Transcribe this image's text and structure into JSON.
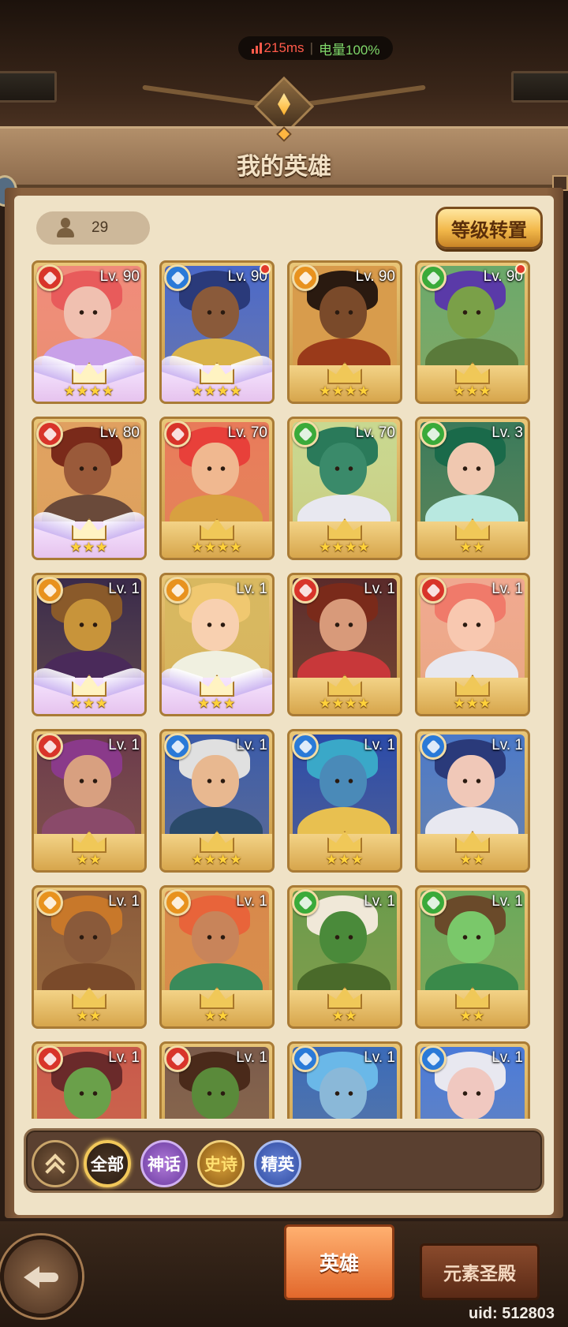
{
  "status": {
    "ping": "215ms",
    "battery": "电量100%"
  },
  "header": {
    "title": "我的英雄"
  },
  "toolbar": {
    "hero_count": "29",
    "level_transfer_label": "等级转置"
  },
  "colors": {
    "fire": "#d8342a",
    "water": "#2a7ad8",
    "earth": "#e8921e",
    "nature": "#3aaa3a"
  },
  "heroes": [
    {
      "level": "Lv. 90",
      "element": "fire",
      "stars": "★★★★",
      "pink": true,
      "dot": false,
      "hair": "#e85b5b",
      "skin": "#f0c0b0",
      "outfit": "#c8a0e8",
      "bg": "#f08a7a"
    },
    {
      "level": "Lv. 90",
      "element": "water",
      "stars": "★★★★",
      "pink": true,
      "dot": true,
      "hair": "#2a3a7a",
      "skin": "#8a5a3a",
      "outfit": "#d9b24a",
      "bg": "#4a68c8"
    },
    {
      "level": "Lv. 90",
      "element": "earth",
      "stars": "★★★★",
      "pink": false,
      "dot": false,
      "hair": "#2a1a10",
      "skin": "#7a4a2a",
      "outfit": "#9a3a1a",
      "bg": "#d89a4a"
    },
    {
      "level": "Lv. 90",
      "element": "nature",
      "stars": "★★★",
      "pink": false,
      "dot": true,
      "hair": "#5a3aa8",
      "skin": "#7aa048",
      "outfit": "#5a7a3a",
      "bg": "#6aa86a"
    },
    {
      "level": "Lv. 80",
      "element": "fire",
      "stars": "★★★",
      "pink": true,
      "dot": false,
      "hair": "#7a2a1a",
      "skin": "#9a5a3a",
      "outfit": "#6a4a3a",
      "bg": "#e0a060"
    },
    {
      "level": "Lv. 70",
      "element": "fire",
      "stars": "★★★★",
      "pink": false,
      "dot": false,
      "hair": "#e8403a",
      "skin": "#f0b890",
      "outfit": "#d8a040",
      "bg": "#e87a5a"
    },
    {
      "level": "Lv. 70",
      "element": "nature",
      "stars": "★★★★",
      "pink": false,
      "dot": false,
      "hair": "#2a7a5a",
      "skin": "#3a8a6a",
      "outfit": "#e8e8f0",
      "bg": "#c8d890"
    },
    {
      "level": "Lv. 3",
      "element": "nature",
      "stars": "★★",
      "pink": false,
      "dot": false,
      "hair": "#1a6a4a",
      "skin": "#f0c8b0",
      "outfit": "#b8e8e0",
      "bg": "#3a7a5a"
    },
    {
      "level": "Lv. 1",
      "element": "earth",
      "stars": "★★★",
      "pink": true,
      "dot": false,
      "hair": "#8a5a2a",
      "skin": "#c8943a",
      "outfit": "#4a2a5a",
      "bg": "#3a2a4a"
    },
    {
      "level": "Lv. 1",
      "element": "earth",
      "stars": "★★★",
      "pink": true,
      "dot": false,
      "hair": "#f0c870",
      "skin": "#f8d0b0",
      "outfit": "#f0f0e0",
      "bg": "#d8b860"
    },
    {
      "level": "Lv. 1",
      "element": "fire",
      "stars": "★★★★",
      "pink": false,
      "dot": false,
      "hair": "#7a2a1a",
      "skin": "#d89a7a",
      "outfit": "#c8383a",
      "bg": "#5a2a2a"
    },
    {
      "level": "Lv. 1",
      "element": "fire",
      "stars": "★★★",
      "pink": false,
      "dot": false,
      "hair": "#f07a6a",
      "skin": "#f8c8b0",
      "outfit": "#e8e8f0",
      "bg": "#f0a890"
    },
    {
      "level": "Lv. 1",
      "element": "fire",
      "stars": "★★",
      "pink": false,
      "dot": false,
      "hair": "#8a3a8a",
      "skin": "#d8a080",
      "outfit": "#8a4a6a",
      "bg": "#6a3a4a"
    },
    {
      "level": "Lv. 1",
      "element": "water",
      "stars": "★★★★",
      "pink": false,
      "dot": false,
      "hair": "#e0e0e0",
      "skin": "#e8b890",
      "outfit": "#2a4a6a",
      "bg": "#3a5aa8"
    },
    {
      "level": "Lv. 1",
      "element": "water",
      "stars": "★★★",
      "pink": false,
      "dot": false,
      "hair": "#3aa8c8",
      "skin": "#4a8ab8",
      "outfit": "#e8c050",
      "bg": "#2a4aa8"
    },
    {
      "level": "Lv. 1",
      "element": "water",
      "stars": "★★",
      "pink": false,
      "dot": false,
      "hair": "#2a3a7a",
      "skin": "#f0c8b8",
      "outfit": "#e8e8f0",
      "bg": "#4a78c8"
    },
    {
      "level": "Lv. 1",
      "element": "earth",
      "stars": "★★",
      "pink": false,
      "dot": false,
      "hair": "#c8782a",
      "skin": "#8a5a3a",
      "outfit": "#7a4a2a",
      "bg": "#8a5a3a"
    },
    {
      "level": "Lv. 1",
      "element": "earth",
      "stars": "★★",
      "pink": false,
      "dot": false,
      "hair": "#e8643a",
      "skin": "#c8845a",
      "outfit": "#3a8a5a",
      "bg": "#d8884a"
    },
    {
      "level": "Lv. 1",
      "element": "nature",
      "stars": "★★",
      "pink": false,
      "dot": false,
      "hair": "#f0e8d8",
      "skin": "#4a8a3a",
      "outfit": "#4a6a2a",
      "bg": "#6a9a4a"
    },
    {
      "level": "Lv. 1",
      "element": "nature",
      "stars": "★★",
      "pink": false,
      "dot": false,
      "hair": "#6a4a2a",
      "skin": "#7ac86a",
      "outfit": "#3a8a4a",
      "bg": "#6aa85a"
    },
    {
      "level": "Lv. 1",
      "element": "fire",
      "stars": "",
      "pink": false,
      "dot": false,
      "hair": "#6a2a2a",
      "skin": "#6aa04a",
      "outfit": "#7a3a2a",
      "bg": "#c8584a"
    },
    {
      "level": "Lv. 1",
      "element": "fire",
      "stars": "",
      "pink": false,
      "dot": false,
      "hair": "#4a2a1a",
      "skin": "#5a8a3a",
      "outfit": "#5a4a3a",
      "bg": "#7a5a4a"
    },
    {
      "level": "Lv. 1",
      "element": "water",
      "stars": "",
      "pink": false,
      "dot": false,
      "hair": "#6ab8e8",
      "skin": "#8ab8d8",
      "outfit": "#4a78b8",
      "bg": "#3a6ab8"
    },
    {
      "level": "Lv. 1",
      "element": "water",
      "stars": "",
      "pink": false,
      "dot": false,
      "hair": "#e8e8f0",
      "skin": "#f0c8c0",
      "outfit": "#8a9ad8",
      "bg": "#4a7ad8"
    }
  ],
  "filters": {
    "all": "全部",
    "myth": "神话",
    "epic": "史诗",
    "elite": "精英"
  },
  "tabs": {
    "heroes": "英雄",
    "element_temple": "元素圣殿"
  },
  "uid": "uid: 512803"
}
